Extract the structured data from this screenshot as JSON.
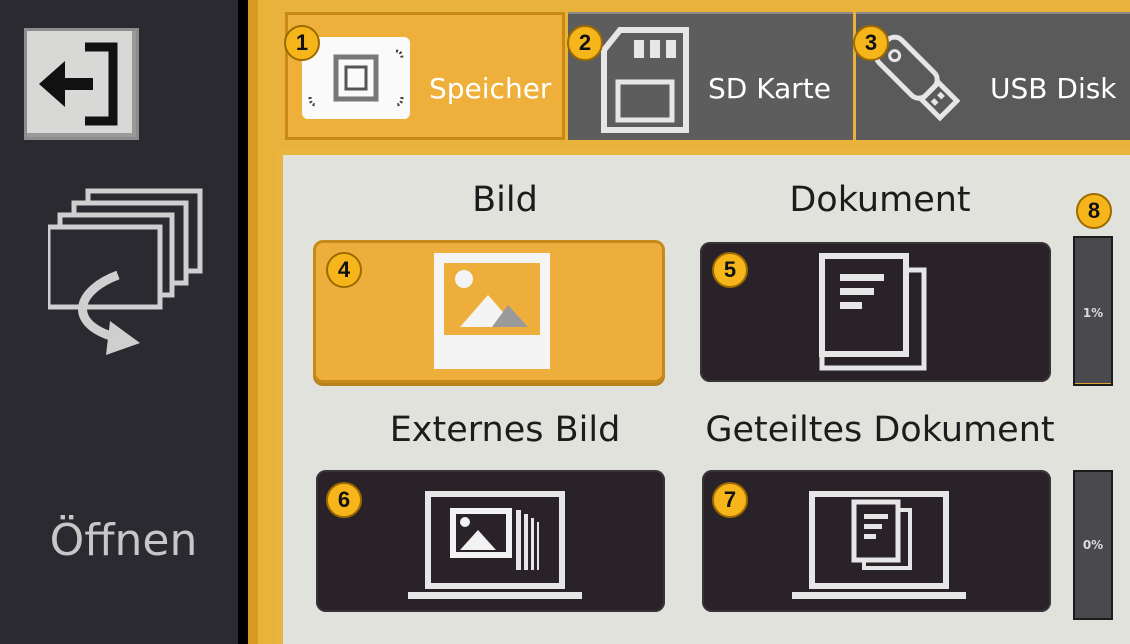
{
  "sidebar": {
    "open_label": "Öffnen"
  },
  "tabs": [
    {
      "label": "Speicher",
      "icon": "internal-memory-icon",
      "active": true,
      "badge": "1"
    },
    {
      "label": "SD Karte",
      "icon": "sd-card-icon",
      "active": false,
      "badge": "2"
    },
    {
      "label": "USB Disk",
      "icon": "usb-stick-icon",
      "active": false,
      "badge": "3"
    }
  ],
  "sections": {
    "bild": "Bild",
    "dokument": "Dokument",
    "externes_bild": "Externes Bild",
    "geteiltes_dokument": "Geteiltes Dokument"
  },
  "tiles": [
    {
      "badge": "4",
      "icon": "image-icon",
      "selected": true
    },
    {
      "badge": "5",
      "icon": "document-icon",
      "selected": false
    },
    {
      "badge": "6",
      "icon": "laptop-image-icon",
      "selected": false
    },
    {
      "badge": "7",
      "icon": "laptop-document-icon",
      "selected": false
    }
  ],
  "storage": {
    "badge": "8",
    "upper_usage": "1%",
    "lower_usage": "0%",
    "upper_fraction": 0.01,
    "lower_fraction": 0.0
  },
  "colors": {
    "accent": "#eeae3b",
    "dark_tile": "#2a2229",
    "panel": "#e2e2dc",
    "sidebar": "#2a2a30"
  }
}
